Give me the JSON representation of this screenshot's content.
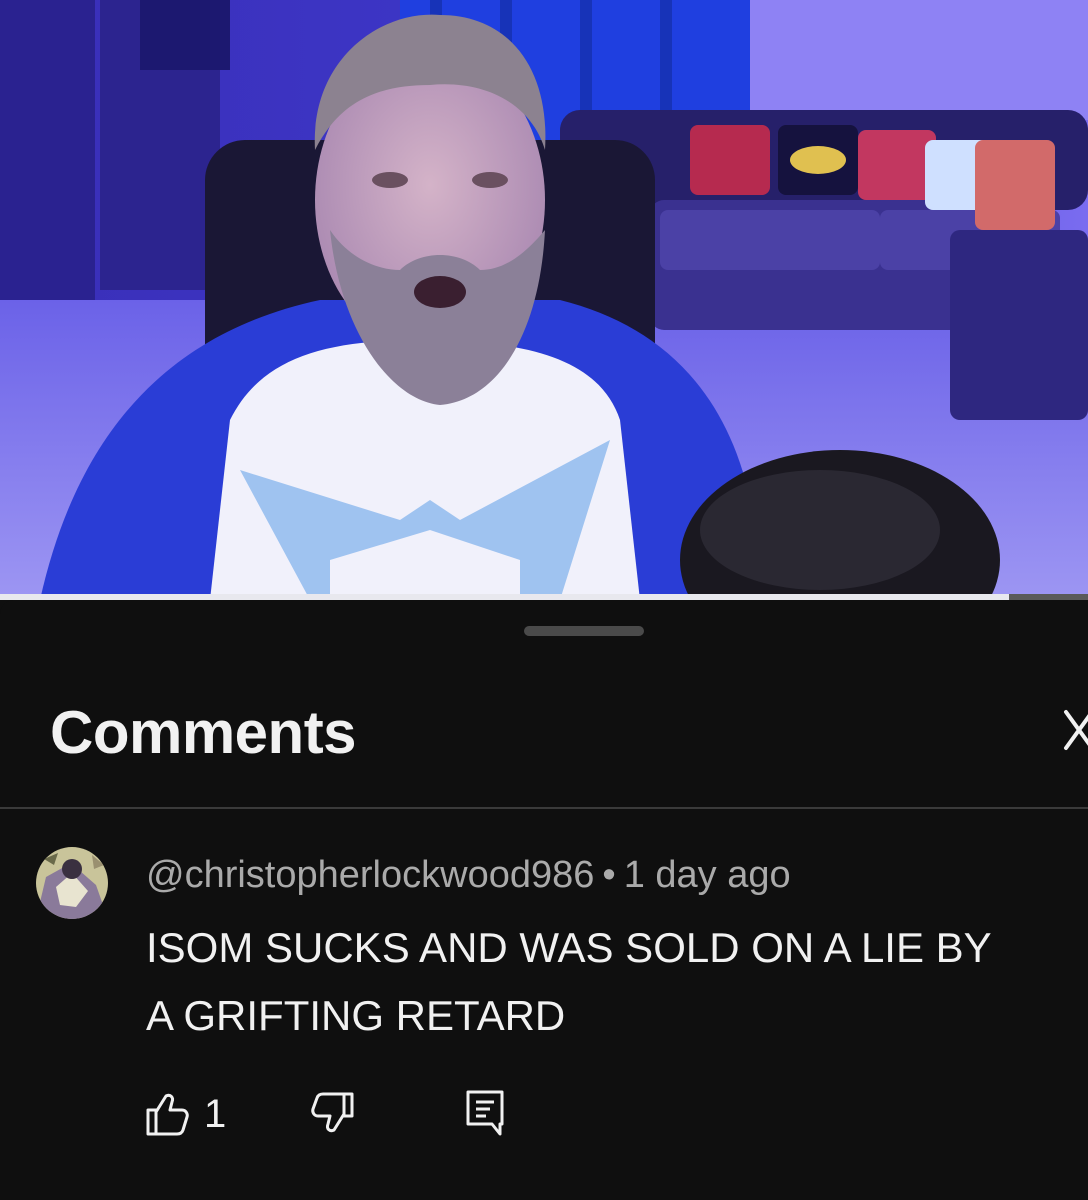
{
  "video": {
    "progress_fraction": 0.927
  },
  "comments_panel": {
    "title": "Comments",
    "close_icon": "close-icon"
  },
  "comment": {
    "author": "@christopherlockwood986",
    "separator": "•",
    "timestamp": "1 day ago",
    "text": "ISOM SUCKS AND WAS SOLD ON A LIE BY\nA GRIFTING RETARD",
    "like_count": "1",
    "icons": {
      "like": "thumbs-up-icon",
      "dislike": "thumbs-down-icon",
      "reply": "reply-icon"
    }
  },
  "colors": {
    "background": "#0f0f0f",
    "text_primary": "#f1f1f1",
    "text_secondary": "#aaaaaa",
    "divider": "#3a3a3a",
    "video_accent_blue": "#2b44d8"
  }
}
